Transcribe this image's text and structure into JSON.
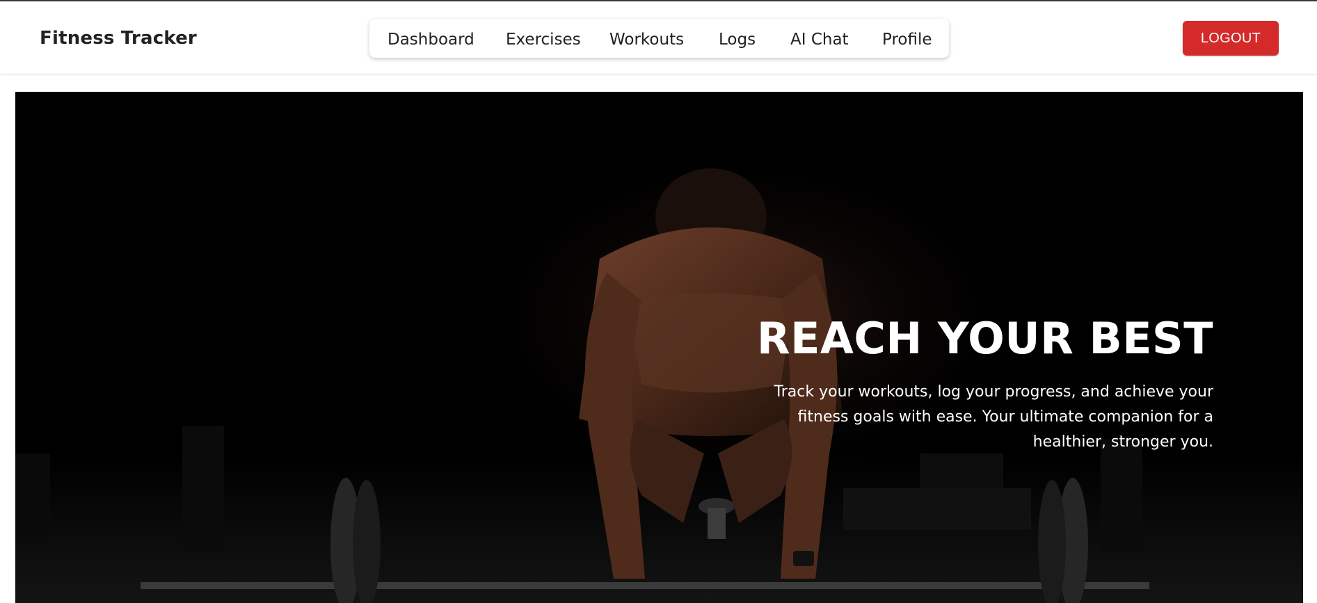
{
  "app": {
    "brand": "Fitness Tracker"
  },
  "nav": {
    "items": [
      {
        "label": "Dashboard"
      },
      {
        "label": "Exercises"
      },
      {
        "label": "Workouts"
      },
      {
        "label": "Logs"
      },
      {
        "label": "AI Chat"
      },
      {
        "label": "Profile"
      }
    ],
    "logout_label": "LOGOUT"
  },
  "hero": {
    "title": "REACH YOUR BEST",
    "subtitle": "Track your workouts, log your progress, and achieve your fitness goals with ease. Your ultimate companion for a healthier, stronger you.",
    "image_subject": "athlete-deadlift-photo"
  },
  "colors": {
    "accent": "#d42a2a",
    "hero_background": "#000000",
    "text_dark": "#222222"
  }
}
